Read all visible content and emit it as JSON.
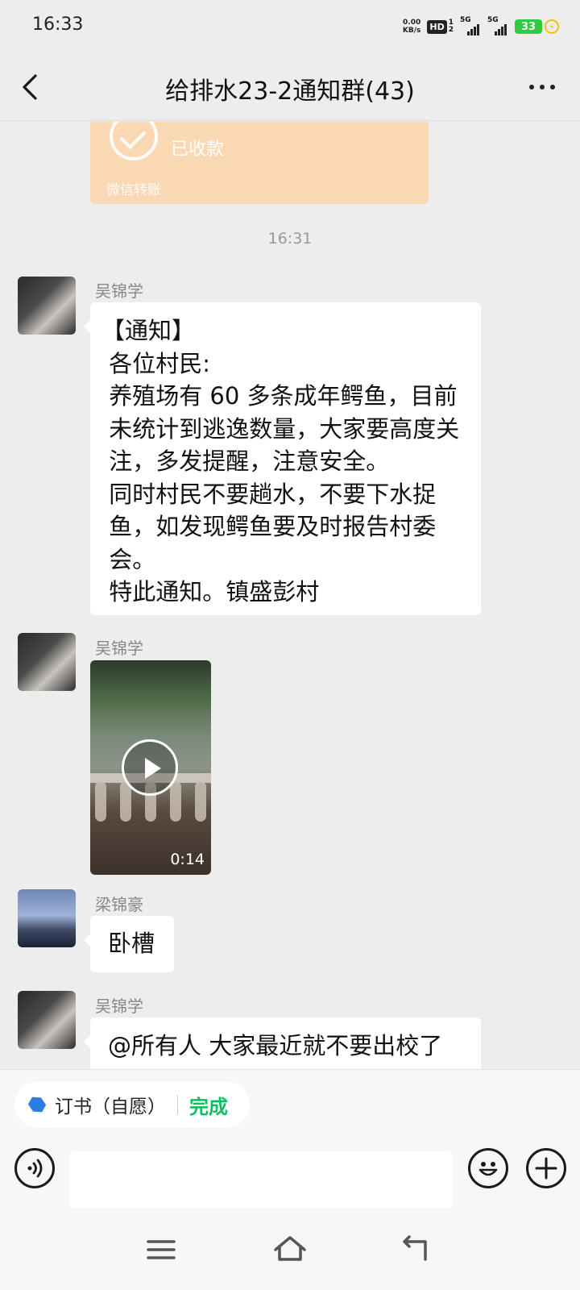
{
  "status_bar": {
    "time": "16:33",
    "net_speed_value": "0.00",
    "net_speed_unit": "KB/s",
    "hd_label": "HD",
    "hd_sub_top": "1",
    "hd_sub_bottom": "2",
    "sim1_label": "5G",
    "sim2_label": "5G",
    "battery_level": "33",
    "icons": [
      "hd-icon",
      "signal-icon",
      "signal-icon",
      "battery-icon",
      "charging-bolt-icon"
    ]
  },
  "header": {
    "title": "给排水23-2通知群(43)",
    "back_icon": "back-chevron-icon",
    "more_icon": "more-dots-icon"
  },
  "chat": {
    "transfer": {
      "status": "已收款",
      "footer": "微信转账",
      "accent_color": "#fbd8b4"
    },
    "time_divider": "16:31",
    "messages": [
      {
        "sender": "吴锦学",
        "type": "text",
        "text": "【通知】\n 各位村民:\n 养殖场有 60 多条成年鳄鱼，目前\n 未统计到逃逸数量，大家要高度关\n 注，多发提醒，注意安全。\n 同时村民不要趟水，不要下水捉\n 鱼，如发现鳄鱼要及时报告村委\n 会。\n 特此通知。镇盛彭村"
      },
      {
        "sender": "吴锦学",
        "type": "video",
        "duration": "0:14"
      },
      {
        "sender": "梁锦豪",
        "type": "text",
        "text": "卧槽"
      },
      {
        "sender": "吴锦学",
        "type": "text",
        "text": "@所有人 大家最近就不要出校了"
      }
    ]
  },
  "quick_action": {
    "label": "订书（自愿）",
    "action": "完成",
    "action_color": "#07c160"
  },
  "input_bar": {
    "placeholder": "",
    "voice_icon": "voice-icon",
    "emoji_icon": "emoji-icon",
    "plus_icon": "plus-icon"
  },
  "system_nav": {
    "icons": [
      "menu-icon",
      "home-icon",
      "back-icon"
    ]
  }
}
